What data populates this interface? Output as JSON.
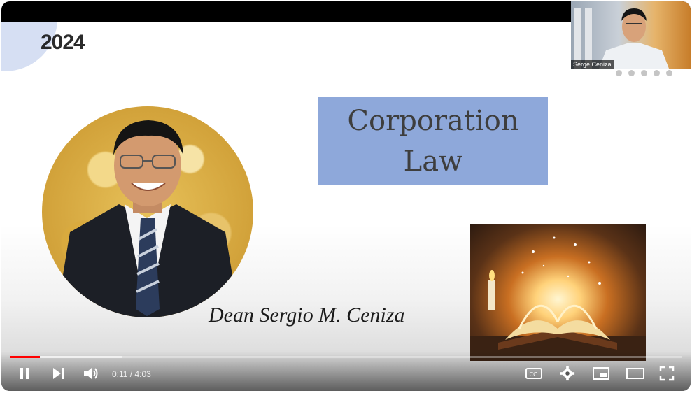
{
  "slide": {
    "title": "Corporation Law",
    "speaker_name": "Dean Sergio M. Ceniza",
    "year_overlay": "2024"
  },
  "camera": {
    "participant_label": "Serge Ceniza",
    "pager_dot_count": 5
  },
  "player": {
    "current_time": "0:11",
    "duration": "4:03",
    "time_display": "0:11 / 4:03",
    "played_fraction": 0.045,
    "buffered_fraction": 0.168,
    "accent_color": "#ff0000",
    "icons": [
      "pause-icon",
      "next-icon",
      "volume-icon",
      "captions-icon",
      "settings-icon",
      "miniplayer-icon",
      "theater-icon",
      "fullscreen-icon"
    ],
    "captions_label": "CC"
  },
  "colors": {
    "title_box": "#8ea8da",
    "title_text": "#3e3e3e"
  }
}
